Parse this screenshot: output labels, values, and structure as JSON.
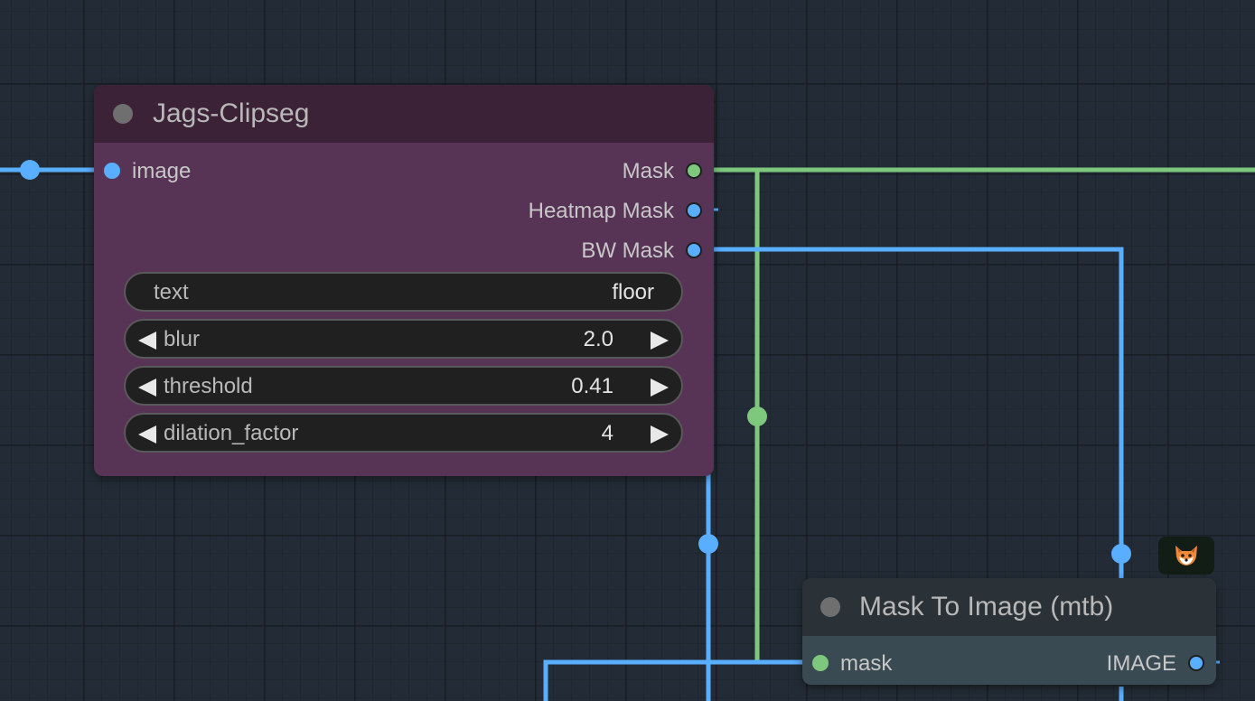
{
  "colors": {
    "canvas": "#232c36",
    "image_link": "#5aaeff",
    "mask_link": "#7ec87e",
    "clipseg_header": "#3b2236",
    "clipseg_body": "#573355",
    "mtb_header": "#2b3237",
    "mtb_body": "#3a4a52"
  },
  "nodes": {
    "clipseg": {
      "title": "Jags-Clipseg",
      "inputs": [
        {
          "label": "image",
          "type": "IMAGE"
        }
      ],
      "outputs": [
        {
          "label": "Mask",
          "type": "MASK"
        },
        {
          "label": "Heatmap Mask",
          "type": "IMAGE"
        },
        {
          "label": "BW Mask",
          "type": "IMAGE"
        }
      ],
      "widgets": {
        "text": {
          "label": "text",
          "value": "floor"
        },
        "blur": {
          "label": "blur",
          "value": "2.0"
        },
        "threshold": {
          "label": "threshold",
          "value": "0.41"
        },
        "dilation_factor": {
          "label": "dilation_factor",
          "value": "4"
        }
      }
    },
    "mask_to_image": {
      "title": "Mask To Image (mtb)",
      "badge_icon": "fox-icon",
      "inputs": [
        {
          "label": "mask",
          "type": "MASK"
        }
      ],
      "outputs": [
        {
          "label": "IMAGE",
          "type": "IMAGE"
        }
      ]
    }
  }
}
